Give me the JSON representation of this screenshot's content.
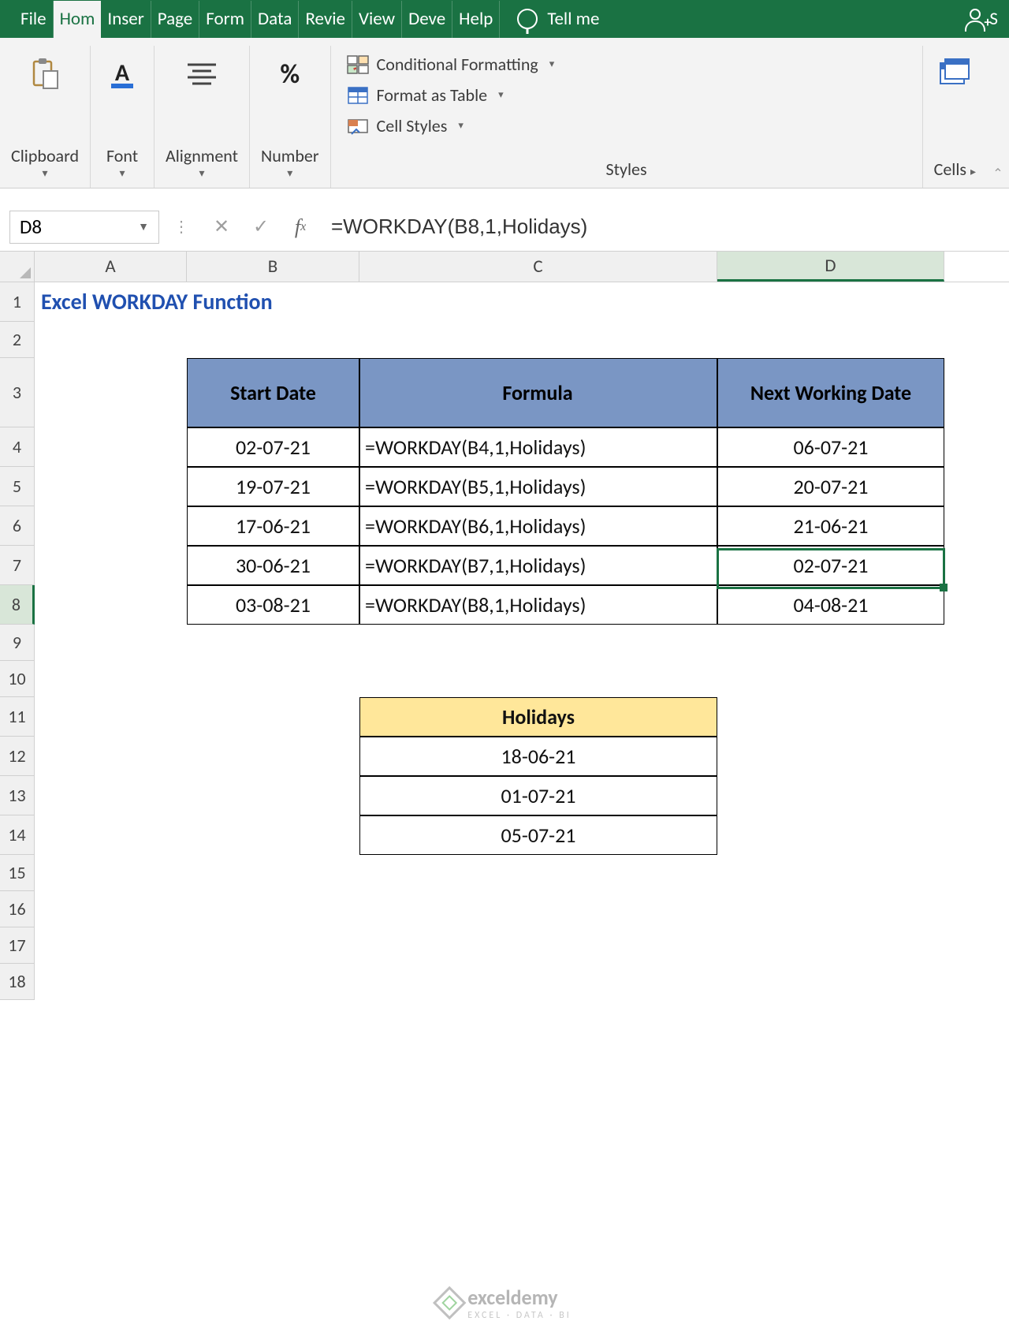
{
  "tabs": {
    "file": "File",
    "home": "Hom",
    "insert": "Inser",
    "page": "Page",
    "formulas": "Form",
    "data": "Data",
    "review": "Revie",
    "view": "View",
    "developer": "Deve",
    "help": "Help",
    "tellme": "Tell me",
    "share": "S"
  },
  "ribbon": {
    "clipboard": "Clipboard",
    "font": "Font",
    "alignment": "Alignment",
    "number": "Number",
    "percent": "%",
    "cond_format": "Conditional Formatting",
    "format_table": "Format as Table",
    "cell_styles": "Cell Styles",
    "styles": "Styles",
    "cells": "Cells"
  },
  "formula_bar": {
    "name": "D8",
    "formula": "=WORKDAY(B8,1,Holidays)"
  },
  "columns": {
    "A": "A",
    "B": "B",
    "C": "C",
    "D": "D"
  },
  "sheet": {
    "title": "Excel WORKDAY Function",
    "headers": {
      "start": "Start Date",
      "formula": "Formula",
      "next": "Next Working Date"
    },
    "rows": [
      {
        "start": "02-07-21",
        "formula": "=WORKDAY(B4,1,Holidays)",
        "next": "06-07-21"
      },
      {
        "start": "19-07-21",
        "formula": "=WORKDAY(B5,1,Holidays)",
        "next": "20-07-21"
      },
      {
        "start": "17-06-21",
        "formula": "=WORKDAY(B6,1,Holidays)",
        "next": "21-06-21"
      },
      {
        "start": "30-06-21",
        "formula": "=WORKDAY(B7,1,Holidays)",
        "next": "02-07-21"
      },
      {
        "start": "03-08-21",
        "formula": "=WORKDAY(B8,1,Holidays)",
        "next": "04-08-21"
      }
    ],
    "holidays_header": "Holidays",
    "holidays": [
      "18-06-21",
      "01-07-21",
      "05-07-21"
    ],
    "row_numbers": [
      "1",
      "2",
      "3",
      "4",
      "5",
      "6",
      "7",
      "8",
      "9",
      "10",
      "11",
      "12",
      "13",
      "14",
      "15",
      "16",
      "17",
      "18"
    ]
  },
  "watermark": {
    "brand": "exceldemy",
    "sub": "EXCEL · DATA · BI"
  }
}
